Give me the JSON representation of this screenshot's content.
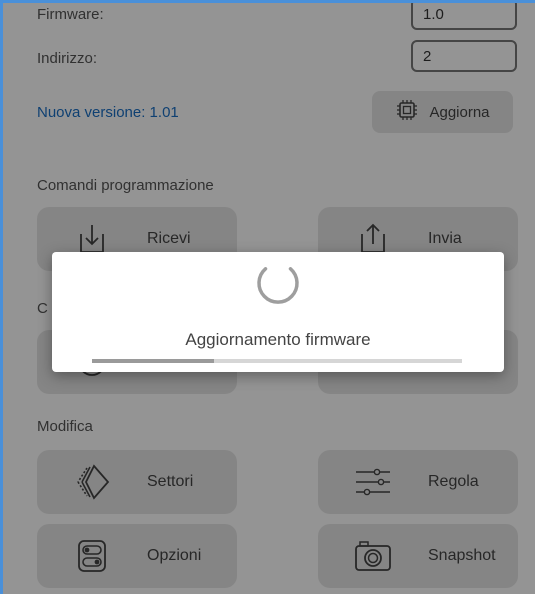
{
  "device": {
    "firmware_label": "Firmware:",
    "firmware_value": "1.0",
    "address_label": "Indirizzo:",
    "address_value": "2",
    "new_version_text": "Nuova versione: 1.01",
    "update_button_label": "Aggiorna"
  },
  "sections": {
    "programming": "Comandi programmazione",
    "hidden_initial": "C",
    "edit": "Modifica"
  },
  "buttons": {
    "receive": "Ricevi",
    "send": "Invia",
    "sectors": "Settori",
    "adjust": "Regola",
    "options": "Opzioni",
    "snapshot": "Snapshot"
  },
  "dialog": {
    "message": "Aggiornamento firmware",
    "progress_fraction": 0.33
  },
  "colors": {
    "link": "#1a6fc4",
    "frame": "#4a90d9"
  }
}
